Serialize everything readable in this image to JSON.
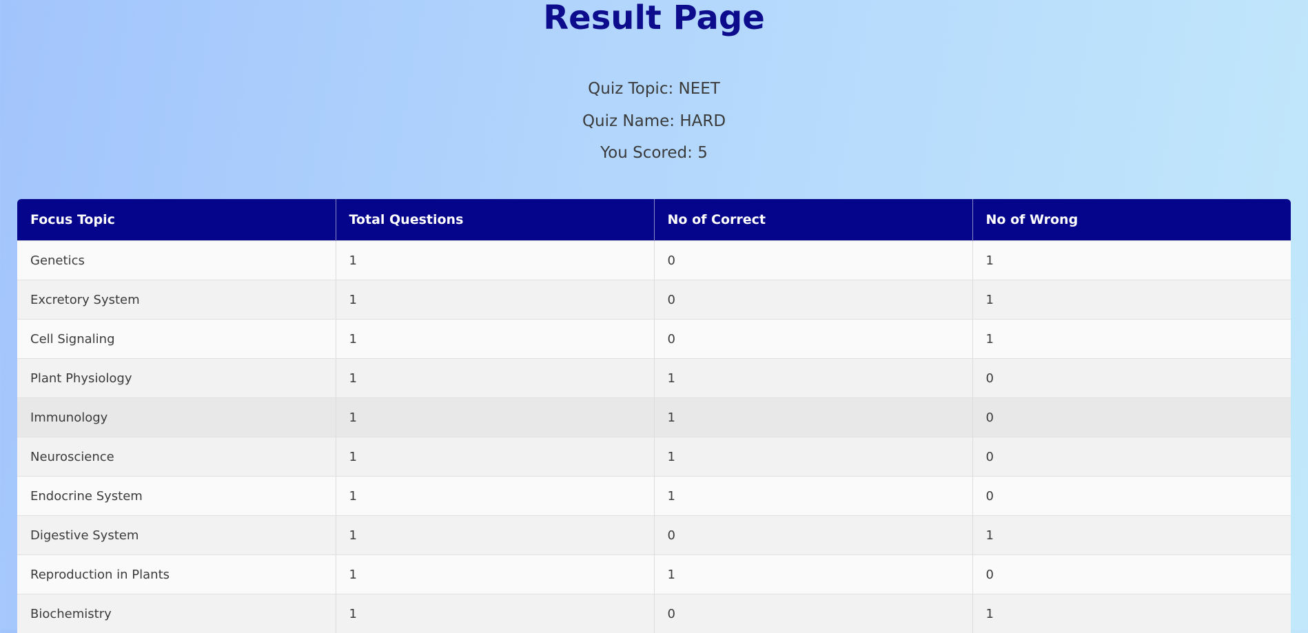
{
  "page": {
    "title": "Result Page"
  },
  "quiz": {
    "topic_line": "Quiz Topic: NEET",
    "name_line": "Quiz Name: HARD",
    "score_line": "You Scored: 5"
  },
  "table": {
    "headers": [
      "Focus Topic",
      "Total Questions",
      "No of Correct",
      "No of Wrong"
    ],
    "rows": [
      [
        "Genetics",
        "1",
        "0",
        "1"
      ],
      [
        "Excretory System",
        "1",
        "0",
        "1"
      ],
      [
        "Cell Signaling",
        "1",
        "0",
        "1"
      ],
      [
        "Plant Physiology",
        "1",
        "1",
        "0"
      ],
      [
        "Immunology",
        "1",
        "1",
        "0"
      ],
      [
        "Neuroscience",
        "1",
        "1",
        "0"
      ],
      [
        "Endocrine System",
        "1",
        "1",
        "0"
      ],
      [
        "Digestive System",
        "1",
        "0",
        "1"
      ],
      [
        "Reproduction in Plants",
        "1",
        "1",
        "0"
      ],
      [
        "Biochemistry",
        "1",
        "0",
        "1"
      ]
    ]
  },
  "colors": {
    "title": "#0c0c8c",
    "header_background": "#05058c",
    "header_text": "#ffffff",
    "background_start": "#a2c4fc",
    "background_end": "#c2e8fb"
  }
}
